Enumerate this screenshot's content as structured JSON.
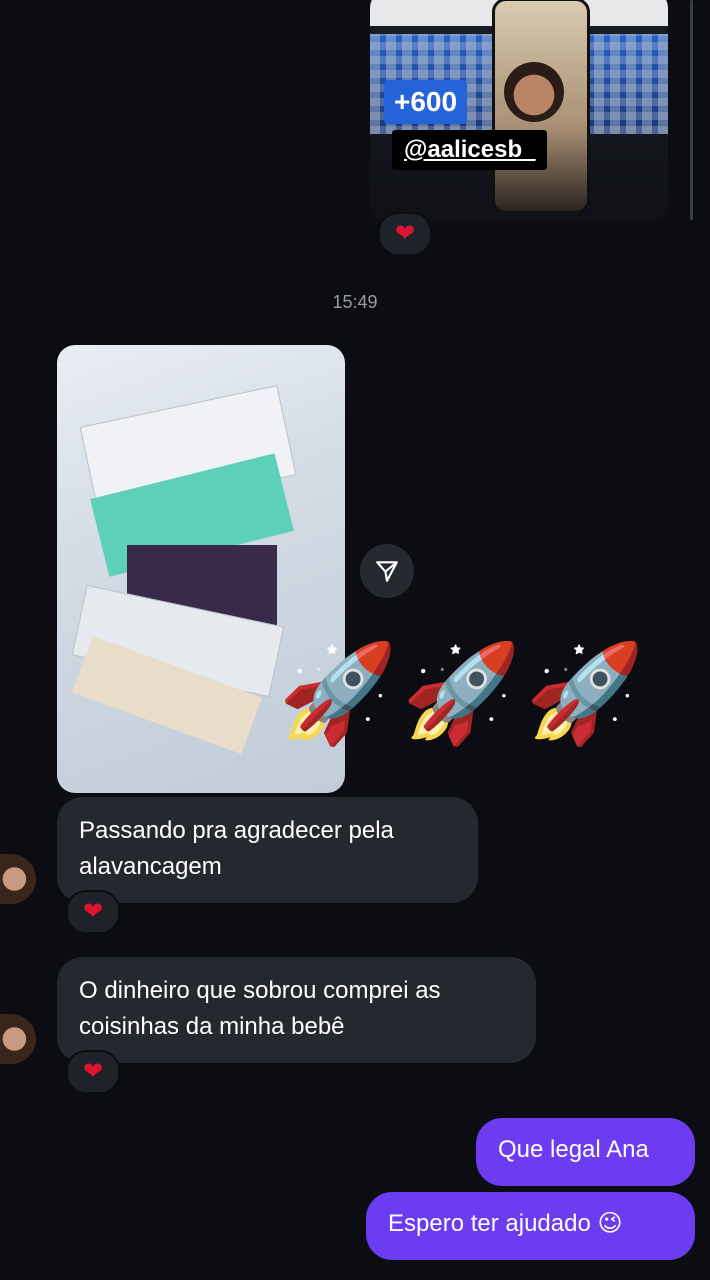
{
  "story": {
    "badge_text": "+600",
    "username": "@aalicesb_"
  },
  "reactions": {
    "heart": "❤"
  },
  "timestamp": "15:49",
  "shared_post": {
    "rockets": "🚀🚀🚀"
  },
  "messages": [
    {
      "sender": "other",
      "text": "Passando pra agradecer pela alavancagem",
      "reaction": "❤"
    },
    {
      "sender": "other",
      "text": "O dinheiro que sobrou comprei as coisinhas da minha bebê",
      "reaction": "❤"
    },
    {
      "sender": "me",
      "text": "Que legal Ana"
    },
    {
      "sender": "me",
      "text": "Espero ter ajudado 😉"
    }
  ],
  "colors": {
    "background": "#0b0d12",
    "incoming_bubble": "#25282f",
    "outgoing_bubble": "#6b3cf0",
    "heart": "#e0142e"
  }
}
